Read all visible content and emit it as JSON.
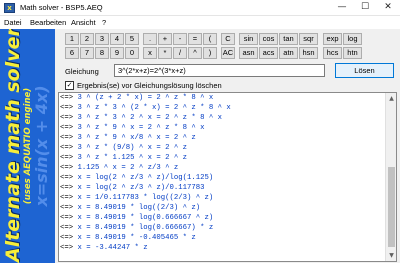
{
  "window": {
    "title": "Math solver - BSP5.AEQ",
    "icon": "app-icon",
    "buttons": {
      "minimize": "—",
      "maximize": "☐",
      "close": "✕"
    }
  },
  "menu": [
    "Datei",
    "Bearbeiten",
    "Ansicht",
    "?"
  ],
  "banner": {
    "title": "Alternate math solver",
    "subtitle": "(uses AEQUATIO engine)",
    "equation": "x=sin(x + 4x)"
  },
  "keypad": {
    "row1": [
      "1",
      "2",
      "3",
      "4",
      "5",
      ".",
      "+",
      "-",
      "=",
      "(",
      "C",
      "sin",
      "cos",
      "tan",
      "sqr",
      "exp",
      "log"
    ],
    "row2": [
      "6",
      "7",
      "8",
      "9",
      "0",
      "x",
      "*",
      "/",
      "^",
      ")",
      "AC",
      "asn",
      "acs",
      "atn",
      "hsn",
      "hcs",
      "htn"
    ]
  },
  "equation": {
    "label": "Gleichung",
    "value": "3^(2*x+z)=2^(3*x+z)"
  },
  "solve_label": "Lösen",
  "clear_option": {
    "label": "Ergebnis(se) vor Gleichungslösung löschen",
    "checked": true
  },
  "results": [
    {
      "sym": "<=>",
      "expr": "3 ^ (z + 2 * x) = 2 ^ z * 8 ^ x"
    },
    {
      "sym": "<=>",
      "expr": "3 ^ z * 3 ^ (2 * x) = 2 ^ z * 8 ^ x"
    },
    {
      "sym": "<=>",
      "expr": "3 ^ z * 3 ^ 2 ^ x = 2 ^ z * 8 ^ x"
    },
    {
      "sym": "<=>",
      "expr": "3 ^ z * 9 ^ x = 2 ^ z * 8 ^ x"
    },
    {
      "sym": "<=>",
      "expr": "3 ^ z * 9 ^ x/8 ^ x = 2 ^ z"
    },
    {
      "sym": "<=>",
      "expr": "3 ^ z * (9/8) ^ x = 2 ^ z"
    },
    {
      "sym": "<=>",
      "expr": "3 ^ z * 1.125 ^ x = 2 ^ z"
    },
    {
      "sym": "<=>",
      "expr": "1.125 ^ x = 2 ^ z/3 ^ z"
    },
    {
      "sym": "<=>",
      "expr": "x = log(2 ^ z/3 ^ z)/log(1.125)"
    },
    {
      "sym": "<=>",
      "expr": "x = log(2 ^ z/3 ^ z)/0.117783"
    },
    {
      "sym": "<=>",
      "expr": "x = 1/0.117783 * log((2/3) ^ z)"
    },
    {
      "sym": "<=>",
      "expr": "x = 8.49019 * log((2/3) ^ z)"
    },
    {
      "sym": "<=>",
      "expr": "x = 8.49019 * log(0.666667 ^ z)"
    },
    {
      "sym": "<=>",
      "expr": "x = 8.49019 * log(0.666667) * z"
    },
    {
      "sym": "<=>",
      "expr": "x = 8.49019 * -0.405465 * z"
    },
    {
      "sym": "<=>",
      "expr": "x = -3.44247 * z"
    }
  ],
  "colors": {
    "banner_bg": "#1e64d2",
    "banner_text": "#f7ee3a",
    "result_text": "#003bc4",
    "accent": "#0078d7"
  }
}
